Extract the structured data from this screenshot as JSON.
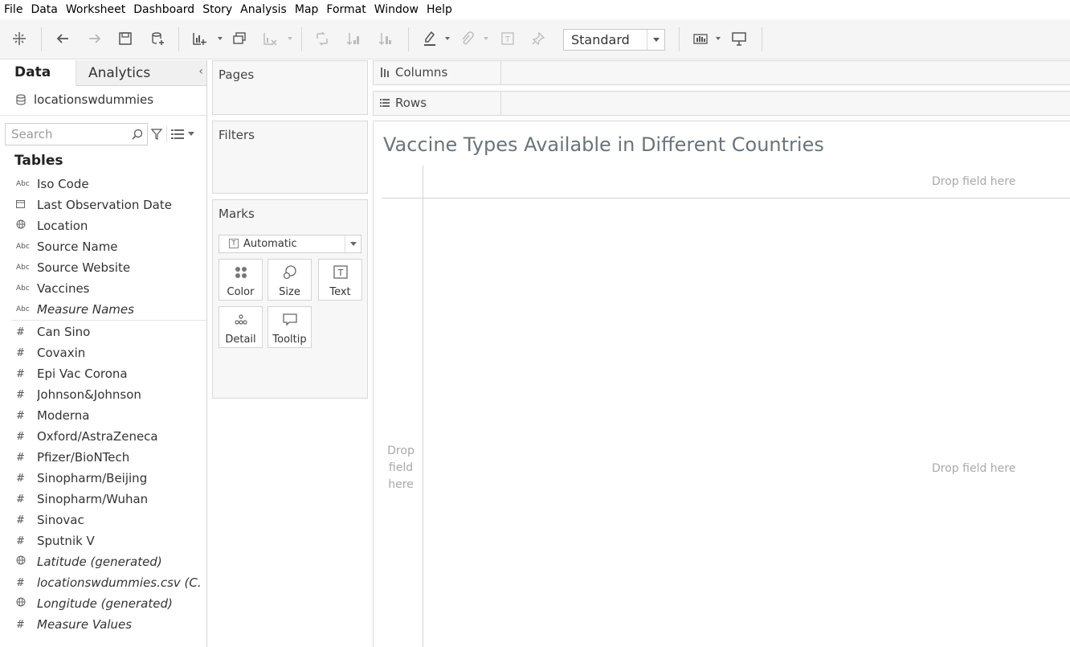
{
  "menu": [
    "File",
    "Data",
    "Worksheet",
    "Dashboard",
    "Story",
    "Analysis",
    "Map",
    "Format",
    "Window",
    "Help"
  ],
  "toolbar": {
    "fit_select": "Standard"
  },
  "data_pane": {
    "tab_data": "Data",
    "tab_analytics": "Analytics",
    "collapse": "‹",
    "datasource": "locationswdummies",
    "search_placeholder": "Search",
    "tables_heading": "Tables",
    "dimensions": [
      {
        "icon": "Abc",
        "name": "Iso Code"
      },
      {
        "icon": "📅",
        "name": "Last Observation Date"
      },
      {
        "icon": "🌐",
        "name": "Location"
      },
      {
        "icon": "Abc",
        "name": "Source Name"
      },
      {
        "icon": "Abc",
        "name": "Source Website"
      },
      {
        "icon": "Abc",
        "name": "Vaccines"
      },
      {
        "icon": "Abc",
        "name": "Measure Names"
      }
    ],
    "measures": [
      {
        "icon": "#",
        "name": "Can Sino"
      },
      {
        "icon": "#",
        "name": "Covaxin"
      },
      {
        "icon": "#",
        "name": "Epi Vac Corona"
      },
      {
        "icon": "#",
        "name": "Johnson&Johnson"
      },
      {
        "icon": "#",
        "name": "Moderna"
      },
      {
        "icon": "#",
        "name": "Oxford/AstraZeneca"
      },
      {
        "icon": "#",
        "name": "Pfizer/BioNTech"
      },
      {
        "icon": "#",
        "name": "Sinopharm/Beijing"
      },
      {
        "icon": "#",
        "name": "Sinopharm/Wuhan"
      },
      {
        "icon": "#",
        "name": "Sinovac"
      },
      {
        "icon": "#",
        "name": "Sputnik V"
      },
      {
        "icon": "🌐",
        "name": "Latitude (generated)"
      },
      {
        "icon": "#",
        "name": "locationswdummies.csv (C..."
      },
      {
        "icon": "🌐",
        "name": "Longitude (generated)"
      },
      {
        "icon": "#",
        "name": "Measure Values"
      }
    ]
  },
  "cards": {
    "pages": "Pages",
    "filters": "Filters",
    "marks": "Marks",
    "mark_type": "Automatic",
    "mark_buttons": {
      "color": "Color",
      "size": "Size",
      "text": "Text",
      "detail": "Detail",
      "tooltip": "Tooltip"
    }
  },
  "shelves": {
    "columns": "Columns",
    "rows": "Rows"
  },
  "view": {
    "title": "Vaccine Types Available in Different Countries",
    "drop_top": "Drop field here",
    "drop_center": "Drop field here",
    "drop_left": [
      "Drop",
      "field",
      "here"
    ]
  }
}
